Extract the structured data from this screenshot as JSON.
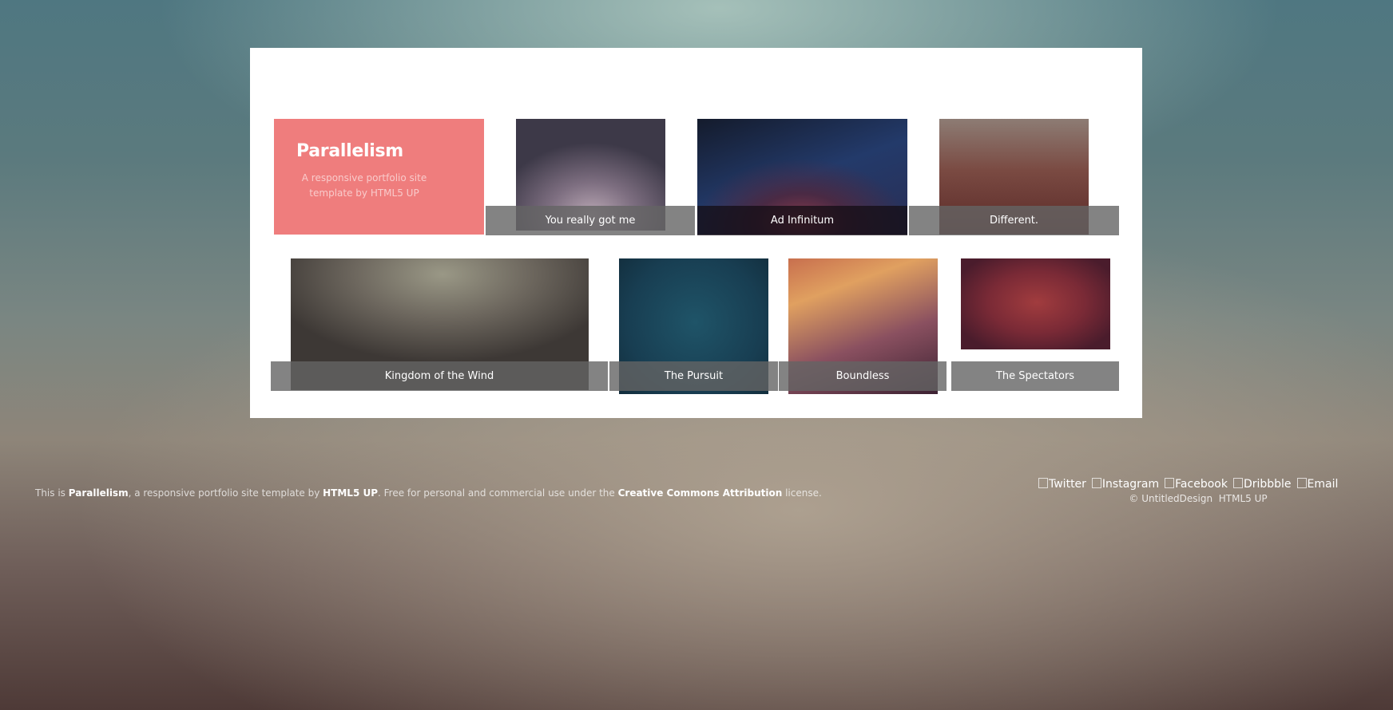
{
  "intro": {
    "title": "Parallelism",
    "subtitle": "A responsive portfolio site template by HTML5 UP"
  },
  "gallery": {
    "items": [
      {
        "caption": "You really got me"
      },
      {
        "caption": "Ad Infinitum"
      },
      {
        "caption": "Different."
      },
      {
        "caption": "Kingdom of the Wind"
      },
      {
        "caption": "The Pursuit"
      },
      {
        "caption": "Boundless"
      },
      {
        "caption": "The Spectators"
      }
    ]
  },
  "footer": {
    "credit": {
      "prefix": "This is ",
      "site_name": "Parallelism",
      "middle": ", a responsive portfolio site template by ",
      "author": "HTML5 UP",
      "license_pre": ". Free for personal and commercial use under the ",
      "license_name": "Creative Commons Attribution",
      "license_post": " license."
    },
    "social": {
      "twitter": "Twitter",
      "instagram": "Instagram",
      "facebook": "Facebook",
      "dribbble": "Dribbble",
      "email": "Email"
    },
    "copyright": "© UntitledDesign",
    "design_by": "HTML5 UP"
  },
  "colors": {
    "intro_background": "#ef7d7d",
    "caption_bar": "#646464"
  }
}
